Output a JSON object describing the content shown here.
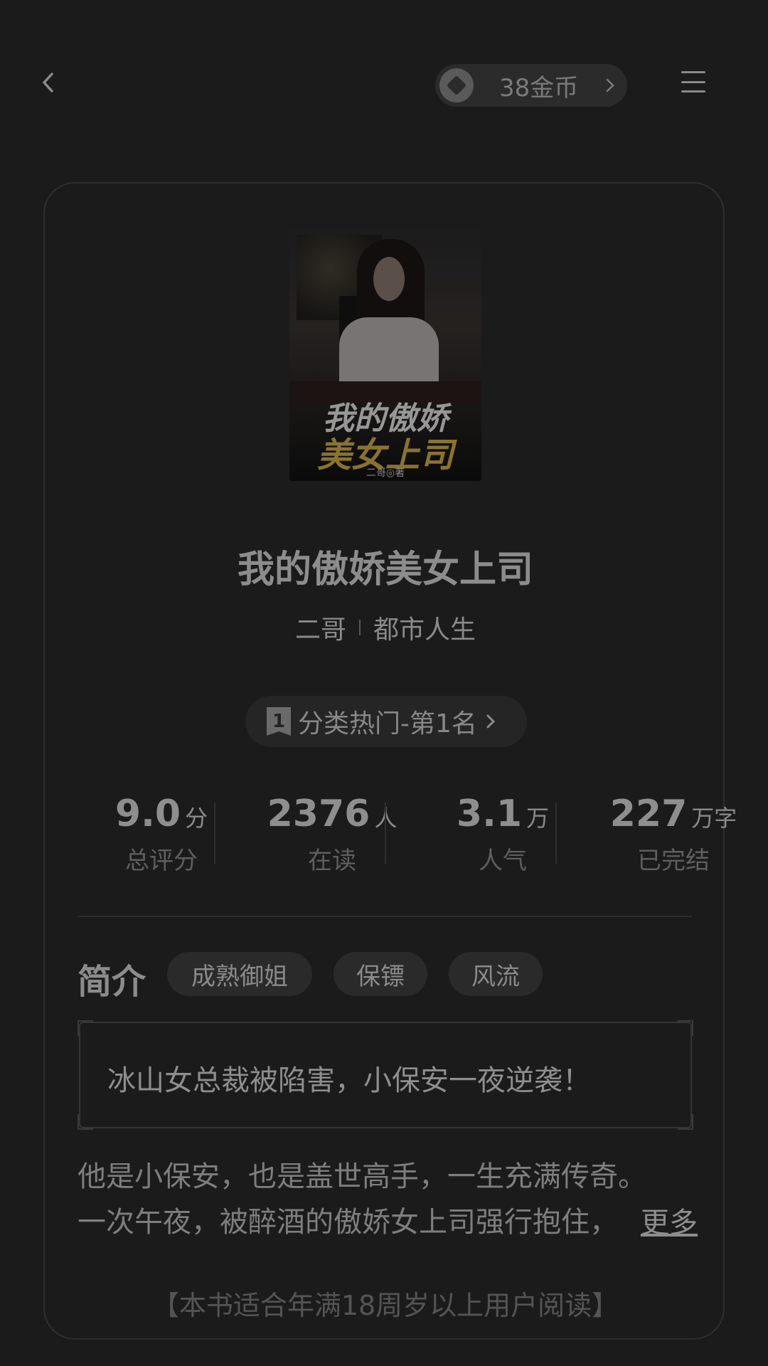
{
  "header": {
    "back_icon": "chevron-left-icon",
    "coins_label": "38金币",
    "coin_icon": "coin-icon",
    "menu_icon": "hamburger-menu-icon"
  },
  "book": {
    "cover": {
      "title_line1": "我的傲娇",
      "title_line2": "美女上司",
      "author": "二哥◎著"
    },
    "title": "我的傲娇美女上司",
    "author": "二哥",
    "category": "都市人生",
    "rank": {
      "badge": "1",
      "label": "分类热门-第1名"
    },
    "stats": [
      {
        "value": "9.0",
        "unit": "分",
        "label": "总评分"
      },
      {
        "value": "2376",
        "unit": "人",
        "label": "在读"
      },
      {
        "value": "3.1",
        "unit": "万",
        "label": "人气"
      },
      {
        "value": "227",
        "unit": "万字",
        "label": "已完结"
      }
    ]
  },
  "intro": {
    "heading": "简介",
    "tags": [
      "成熟御姐",
      "保镖",
      "风流"
    ],
    "tagline": "冰山女总裁被陷害，小保安一夜逆袭！",
    "description_lines": [
      "他是小保安，也是盖世高手，一生充满传奇。",
      "一次午夜，被醉酒的傲娇女上司强行抱住，"
    ],
    "more_label": "更多",
    "age_notice": "【本书适合年满18周岁以上用户阅读】"
  }
}
